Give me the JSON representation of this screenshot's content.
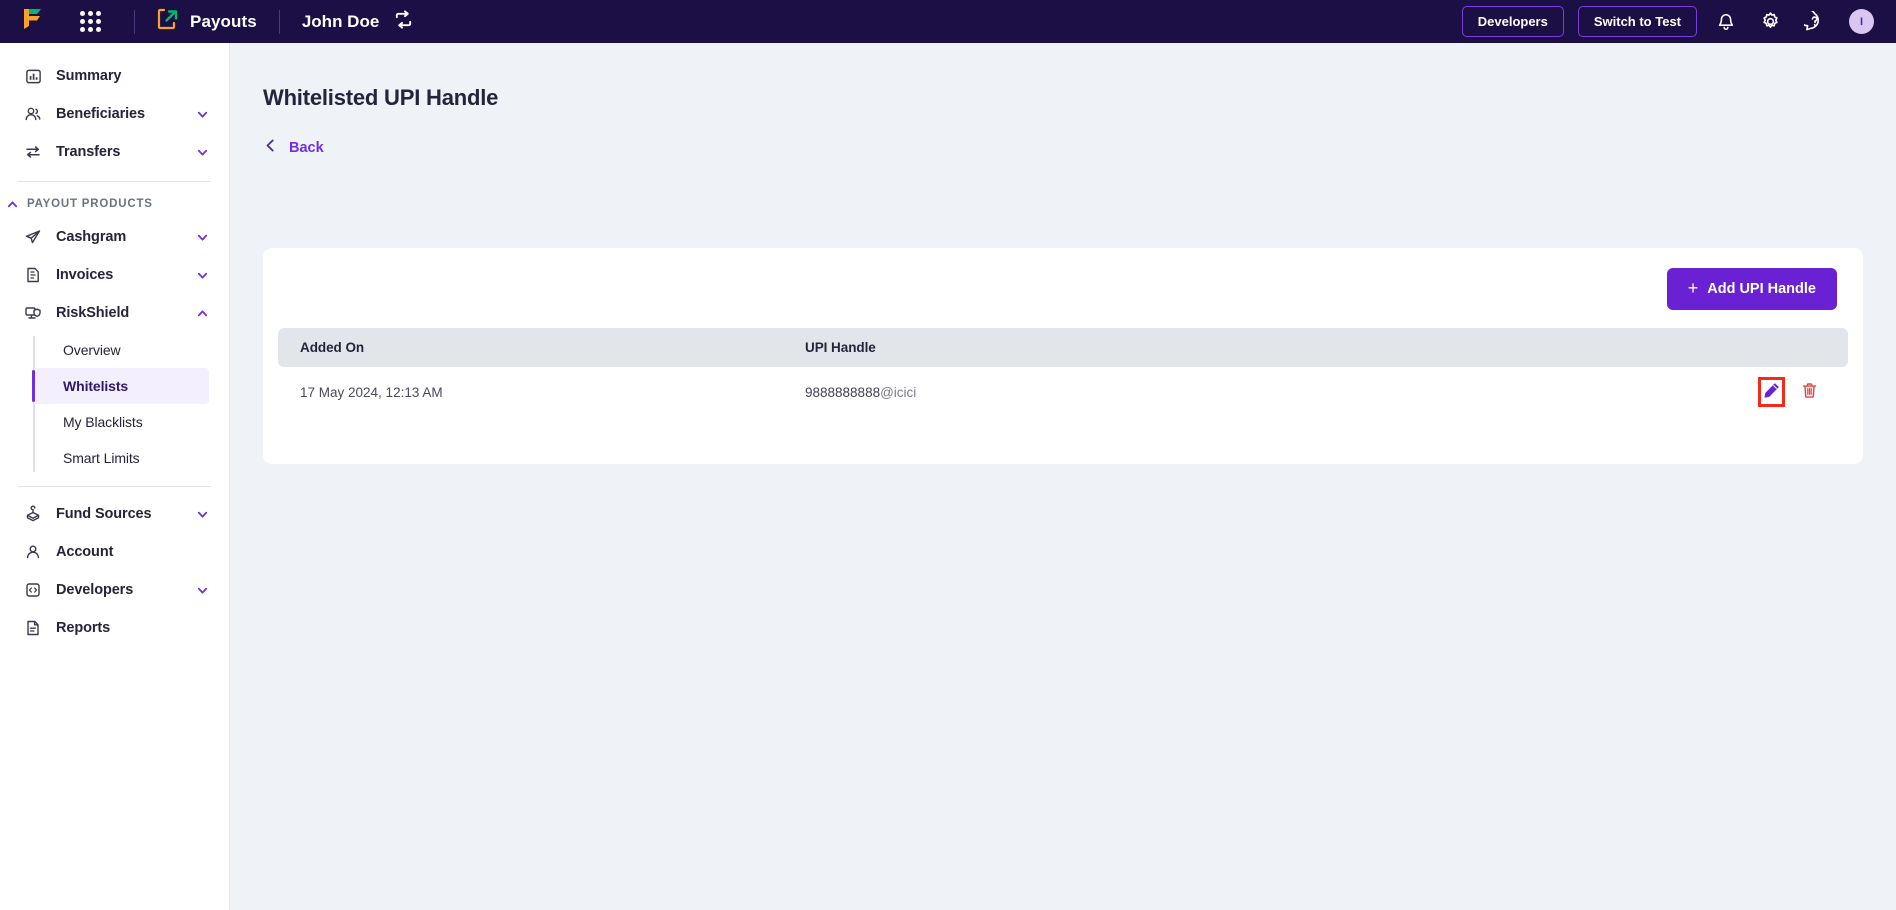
{
  "topnav": {
    "logo_icon": "cashfree-logo-icon",
    "apps_icon": "apps-grid-icon",
    "product_icon": "payouts-icon",
    "product_label": "Payouts",
    "account_name": "John Doe",
    "switch_account_icon": "switch-account-icon",
    "developers_label": "Developers",
    "switch_to_test_label": "Switch to Test",
    "bell_icon": "notification-bell-icon",
    "gear_icon": "settings-gear-icon",
    "help_icon": "help-question-icon",
    "avatar_initial": "I",
    "colors": {
      "bar_bg": "#1b0f45",
      "outline_btn_border": "#7a3ee0",
      "logo_orange": "#f7a32b",
      "logo_green": "#00b96b"
    }
  },
  "sidebar": {
    "items": [
      {
        "label": "Summary",
        "icon": "chart-bar-icon",
        "expandable": false
      },
      {
        "label": "Beneficiaries",
        "icon": "users-icon",
        "expandable": true
      },
      {
        "label": "Transfers",
        "icon": "transfer-arrows-icon",
        "expandable": true
      }
    ],
    "section": {
      "label": "PAYOUT PRODUCTS",
      "collapse_icon": "chevron-up-icon",
      "items": [
        {
          "label": "Cashgram",
          "icon": "paper-plane-icon",
          "expandable": true,
          "expanded": false
        },
        {
          "label": "Invoices",
          "icon": "invoice-doc-icon",
          "expandable": true,
          "expanded": false
        },
        {
          "label": "RiskShield",
          "icon": "riskshield-icon",
          "expandable": true,
          "expanded": true
        }
      ],
      "riskshield_children": [
        {
          "label": "Overview",
          "active": false
        },
        {
          "label": "Whitelists",
          "active": true
        },
        {
          "label": "My Blacklists",
          "active": false
        },
        {
          "label": "Smart Limits",
          "active": false
        }
      ]
    },
    "bottom_items": [
      {
        "label": "Fund Sources",
        "icon": "fund-source-icon",
        "expandable": true
      },
      {
        "label": "Account",
        "icon": "person-icon",
        "expandable": false
      },
      {
        "label": "Developers",
        "icon": "code-brackets-icon",
        "expandable": true
      },
      {
        "label": "Reports",
        "icon": "report-doc-icon",
        "expandable": false
      }
    ],
    "colors": {
      "active_bg": "#f4efff",
      "active_accent": "#7130e0"
    }
  },
  "main": {
    "page_title": "Whitelisted UPI Handle",
    "back_label": "Back",
    "back_icon": "chevron-left-icon",
    "add_button_label": "Add UPI Handle",
    "add_button_icon": "plus-icon",
    "table": {
      "columns": [
        "Added On",
        "UPI Handle",
        ""
      ],
      "rows": [
        {
          "added_on": "17 May 2024, 12:13 AM",
          "handle_main": "9888888888",
          "handle_suffix": "@icici",
          "edit_icon": "pencil-edit-icon",
          "delete_icon": "trash-delete-icon"
        }
      ]
    },
    "colors": {
      "bg": "#eff2f6",
      "card": "#ffffff",
      "table_header_bg": "#e2e5ea",
      "primary": "#6a21d4",
      "highlight_box": "#f42b1a",
      "trash": "#e8413a"
    }
  }
}
